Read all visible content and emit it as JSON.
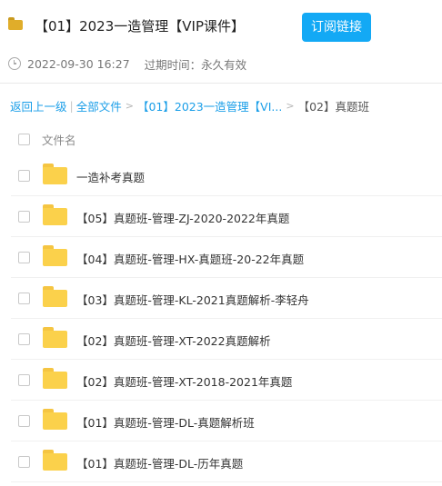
{
  "header": {
    "title": "【01】2023一造管理【VIP课件】",
    "subscribe_label": "订阅链接",
    "timestamp": "2022-09-30 16:27",
    "expiry_label": "过期时间：",
    "expiry_value": "永久有效"
  },
  "breadcrumb": {
    "back": "返回上一级",
    "pipe": "|",
    "all_files": "全部文件",
    "separator": ">",
    "parent": "【01】2023一造管理【VI...",
    "current": "【02】真题班"
  },
  "list": {
    "column_name": "文件名",
    "items": [
      {
        "name": "一造补考真题"
      },
      {
        "name": "【05】真题班-管理-ZJ-2020-2022年真题"
      },
      {
        "name": "【04】真题班-管理-HX-真题班-20-22年真题"
      },
      {
        "name": "【03】真题班-管理-KL-2021真题解析-李轻舟"
      },
      {
        "name": "【02】真题班-管理-XT-2022真题解析"
      },
      {
        "name": "【02】真题班-管理-XT-2018-2021年真题"
      },
      {
        "name": "【01】真题班-管理-DL-真题解析班"
      },
      {
        "name": "【01】真题班-管理-DL-历年真题"
      }
    ]
  },
  "colors": {
    "accent": "#13a9f5",
    "link": "#1a9ee8",
    "folder": "#fbd14b"
  },
  "icons": {
    "title": "folder-icon",
    "meta": "clock-icon",
    "row": "folder-icon"
  }
}
